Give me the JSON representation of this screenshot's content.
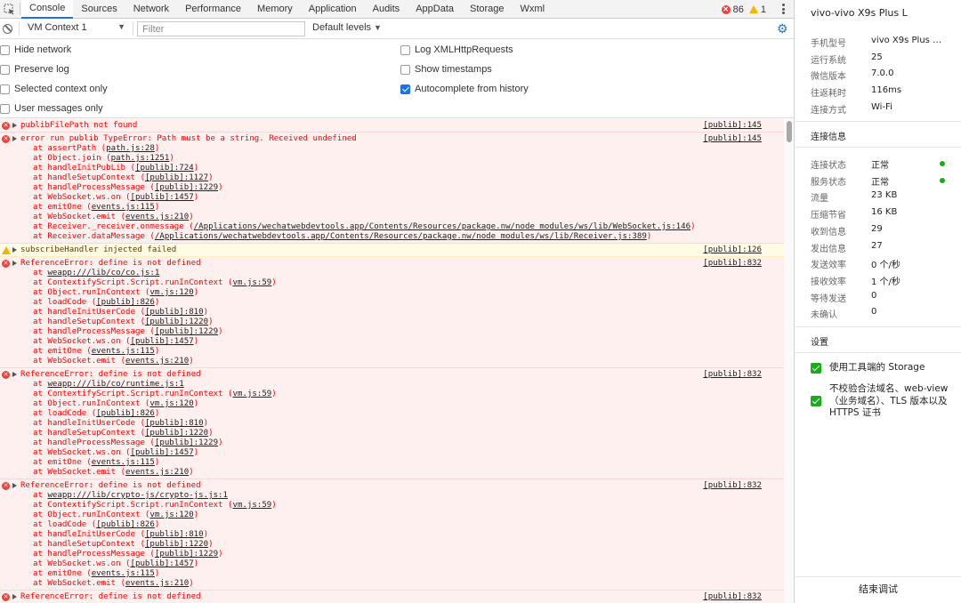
{
  "tabs": [
    "Console",
    "Sources",
    "Network",
    "Performance",
    "Memory",
    "Application",
    "Audits",
    "AppData",
    "Storage",
    "Wxml"
  ],
  "counts": {
    "errors": "86",
    "warnings": "1"
  },
  "toolbar": {
    "context": "VM Context 1",
    "filter_placeholder": "Filter",
    "levels": "Default levels"
  },
  "settings": {
    "hide_network": "Hide network",
    "preserve_log": "Preserve log",
    "selected_context": "Selected context only",
    "user_messages": "User messages only",
    "log_xhr": "Log XMLHttpRequests",
    "show_timestamps": "Show timestamps",
    "autocomplete": "Autocomplete from history"
  },
  "console": [
    {
      "level": "error",
      "text": "publibFilePath not found",
      "src": "[publib]:145",
      "stack": []
    },
    {
      "level": "error",
      "text": "error run publib TypeError: Path must be a string. Received undefined",
      "src": "[publib]:145",
      "stack": [
        [
          "at assertPath (",
          "path.js:28",
          ")"
        ],
        [
          "at Object.join (",
          "path.js:1251",
          ")"
        ],
        [
          "at handleInitPubLib (",
          "[publib]:724",
          ")"
        ],
        [
          "at handleSetupContext (",
          "[publib]:1127",
          ")"
        ],
        [
          "at handleProcessMessage (",
          "[publib]:1229",
          ")"
        ],
        [
          "at WebSocket.ws.on (",
          "[publib]:1457",
          ")"
        ],
        [
          "at emitOne (",
          "events.js:115",
          ")"
        ],
        [
          "at WebSocket.emit (",
          "events.js:210",
          ")"
        ],
        [
          "at Receiver._receiver.onmessage (",
          "/Applications/wechatwebdevtools.app/Contents/Resources/package.nw/node_modules/ws/lib/WebSocket.js:146",
          ")"
        ],
        [
          "at Receiver.dataMessage (",
          "/Applications/wechatwebdevtools.app/Contents/Resources/package.nw/node_modules/ws/lib/Receiver.js:389",
          ")"
        ]
      ]
    },
    {
      "level": "warn",
      "text": "subscribeHandler injected failed",
      "src": "[publib]:126",
      "stack": []
    },
    {
      "level": "error",
      "text": "ReferenceError: define is not defined",
      "src": "[publib]:832",
      "stack": [
        [
          "at ",
          "weapp:///lib/co/co.js:1",
          ""
        ],
        [
          "at ContextifyScript.Script.runInContext (",
          "vm.js:59",
          ")"
        ],
        [
          "at Object.runInContext (",
          "vm.js:120",
          ")"
        ],
        [
          "at loadCode (",
          "[publib]:826",
          ")"
        ],
        [
          "at handleInitUserCode (",
          "[publib]:810",
          ")"
        ],
        [
          "at handleSetupContext (",
          "[publib]:1220",
          ")"
        ],
        [
          "at handleProcessMessage (",
          "[publib]:1229",
          ")"
        ],
        [
          "at WebSocket.ws.on (",
          "[publib]:1457",
          ")"
        ],
        [
          "at emitOne (",
          "events.js:115",
          ")"
        ],
        [
          "at WebSocket.emit (",
          "events.js:210",
          ")"
        ]
      ]
    },
    {
      "level": "error",
      "text": "ReferenceError: define is not defined",
      "src": "[publib]:832",
      "stack": [
        [
          "at ",
          "weapp:///lib/co/runtime.js:1",
          ""
        ],
        [
          "at ContextifyScript.Script.runInContext (",
          "vm.js:59",
          ")"
        ],
        [
          "at Object.runInContext (",
          "vm.js:120",
          ")"
        ],
        [
          "at loadCode (",
          "[publib]:826",
          ")"
        ],
        [
          "at handleInitUserCode (",
          "[publib]:810",
          ")"
        ],
        [
          "at handleSetupContext (",
          "[publib]:1220",
          ")"
        ],
        [
          "at handleProcessMessage (",
          "[publib]:1229",
          ")"
        ],
        [
          "at WebSocket.ws.on (",
          "[publib]:1457",
          ")"
        ],
        [
          "at emitOne (",
          "events.js:115",
          ")"
        ],
        [
          "at WebSocket.emit (",
          "events.js:210",
          ")"
        ]
      ]
    },
    {
      "level": "error",
      "text": "ReferenceError: define is not defined",
      "src": "[publib]:832",
      "stack": [
        [
          "at ",
          "weapp:///lib/crypto-js/crypto-js.js:1",
          ""
        ],
        [
          "at ContextifyScript.Script.runInContext (",
          "vm.js:59",
          ")"
        ],
        [
          "at Object.runInContext (",
          "vm.js:120",
          ")"
        ],
        [
          "at loadCode (",
          "[publib]:826",
          ")"
        ],
        [
          "at handleInitUserCode (",
          "[publib]:810",
          ")"
        ],
        [
          "at handleSetupContext (",
          "[publib]:1220",
          ")"
        ],
        [
          "at handleProcessMessage (",
          "[publib]:1229",
          ")"
        ],
        [
          "at WebSocket.ws.on (",
          "[publib]:1457",
          ")"
        ],
        [
          "at emitOne (",
          "events.js:115",
          ")"
        ],
        [
          "at WebSocket.emit (",
          "events.js:210",
          ")"
        ]
      ]
    },
    {
      "level": "error",
      "text": "ReferenceError: define is not defined",
      "src": "[publib]:832",
      "stack": []
    }
  ],
  "device": {
    "title": "vivo-vivo X9s Plus L",
    "info": [
      {
        "k": "手机型号",
        "v": "vivo X9s Plus L..."
      },
      {
        "k": "运行系统",
        "v": "25"
      },
      {
        "k": "微信版本",
        "v": "7.0.0"
      },
      {
        "k": "往返耗时",
        "v": "116ms"
      },
      {
        "k": "连接方式",
        "v": "Wi-Fi"
      }
    ],
    "conn_title": "连接信息",
    "conn": [
      {
        "k": "连接状态",
        "v": "正常",
        "dot": true
      },
      {
        "k": "服务状态",
        "v": "正常",
        "dot": true
      },
      {
        "k": "流量",
        "v": "23 KB"
      },
      {
        "k": "压缩节省",
        "v": "16 KB"
      },
      {
        "k": "收到信息",
        "v": "29"
      },
      {
        "k": "发出信息",
        "v": "27"
      },
      {
        "k": "发送效率",
        "v": "0 个/秒"
      },
      {
        "k": "接收效率",
        "v": "1 个/秒"
      },
      {
        "k": "等待发送",
        "v": "0"
      },
      {
        "k": "未确认",
        "v": "0"
      }
    ],
    "settings_title": "设置",
    "setting1": "使用工具端的 Storage",
    "setting2": "不校验合法域名、web-view（业务域名）、TLS 版本以及 HTTPS 证书",
    "stop": "结束调试",
    "status_color": "#1aad19"
  }
}
